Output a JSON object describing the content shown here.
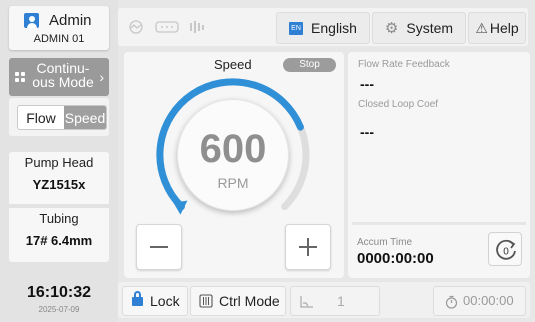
{
  "user": {
    "name": "Admin",
    "id": "ADMIN 01"
  },
  "mode": {
    "label": "Continu-\nous Mode"
  },
  "flow_speed": {
    "flow_label": "Flow",
    "speed_label": "Speed",
    "selected": "Speed"
  },
  "pump": {
    "head_label": "Pump Head",
    "head_value": "YZ1515x",
    "tubing_label": "Tubing",
    "tubing_value": "17# 6.4mm"
  },
  "clock": {
    "time": "16:10:32",
    "date": "2025-07-09"
  },
  "topbar": {
    "language_label": "English",
    "language_badge": "EN",
    "system_label": "System",
    "help_label": "Help"
  },
  "speed": {
    "title": "Speed",
    "status": "Stop",
    "value": "600",
    "unit": "RPM",
    "dial_level": 0.75
  },
  "info": {
    "flow_feedback_label": "Flow Rate Feedback",
    "flow_feedback_value": "---",
    "closed_loop_label": "Closed Loop Coef",
    "closed_loop_value": "---",
    "accum_label": "Accum Time",
    "accum_value": "0000:00:00",
    "reset_count": "0"
  },
  "bottom": {
    "lock_label": "Lock",
    "ctrl_label": "Ctrl Mode",
    "ramp_value": "1",
    "timer_value": "00:00:00"
  },
  "colors": {
    "accent": "#2f7fd5",
    "gauge": "#2f90d8",
    "mode_bg": "#9a9a9a"
  }
}
